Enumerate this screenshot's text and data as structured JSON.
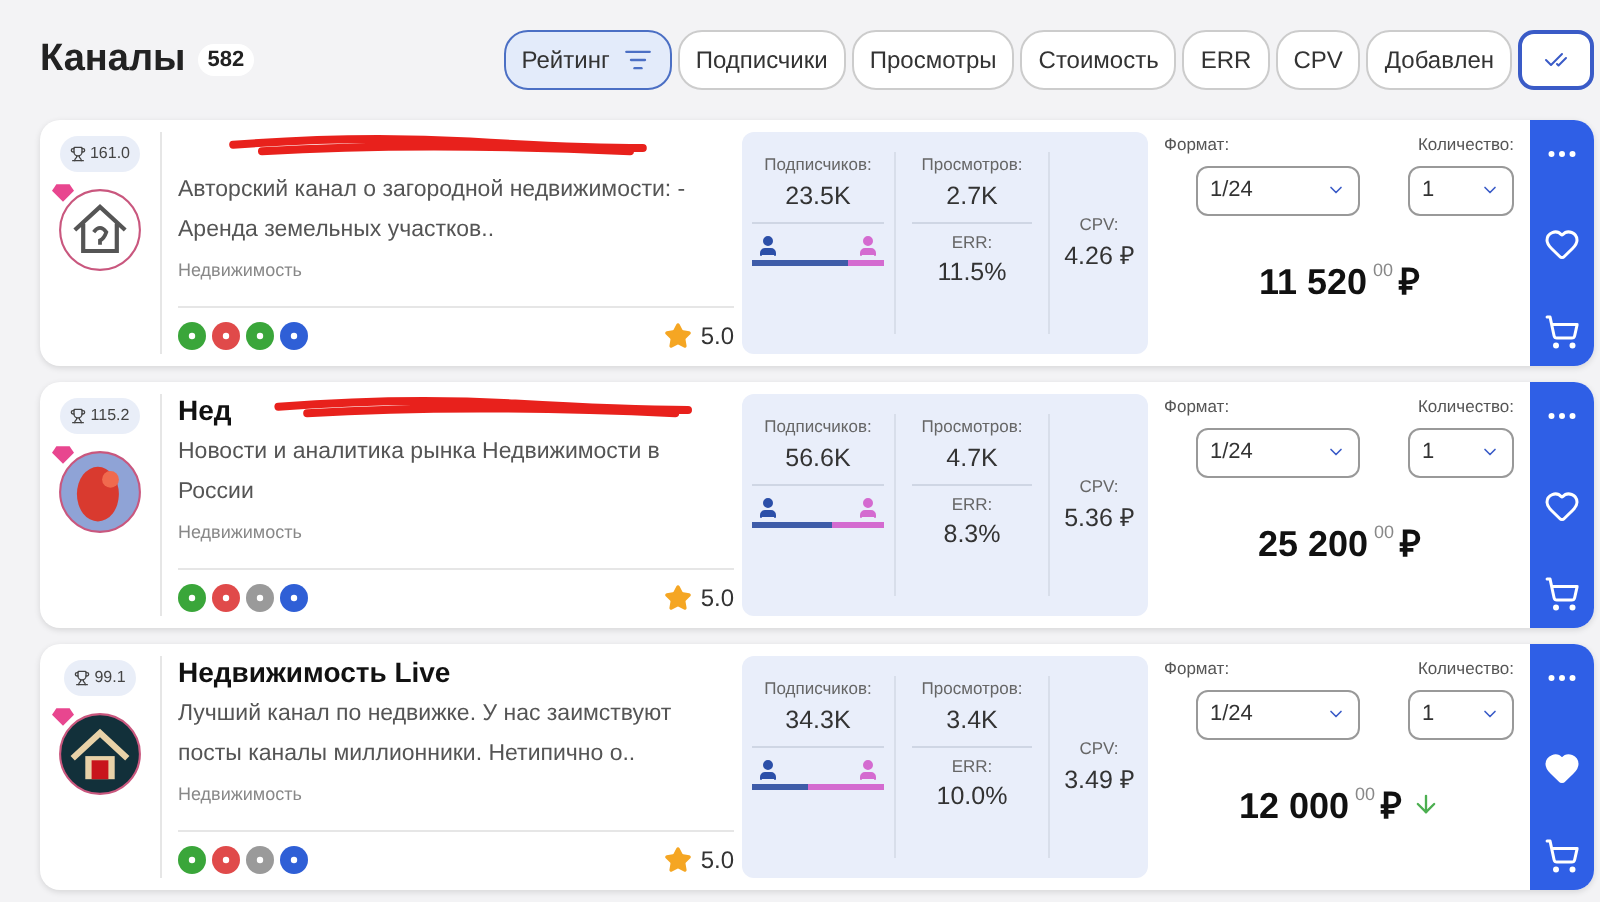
{
  "header": {
    "title": "Каналы",
    "count": "582"
  },
  "sort_tabs": [
    {
      "label": "Рейтинг",
      "selected": true
    },
    {
      "label": "Подписчики",
      "selected": false
    },
    {
      "label": "Просмотры",
      "selected": false
    },
    {
      "label": "Стоимость",
      "selected": false
    },
    {
      "label": "ERR",
      "selected": false
    },
    {
      "label": "CPV",
      "selected": false
    },
    {
      "label": "Добавлен",
      "selected": false
    }
  ],
  "channels": [
    {
      "rating": "161.0",
      "redacted": true,
      "description": "Авторский канал о загородной недвижимости: - Аренда земельных участков..",
      "category": "Недвижимость",
      "badges": [
        {
          "color": "#3aa63a"
        },
        {
          "color": "#e04a4a"
        },
        {
          "color": "#3aa63a"
        },
        {
          "color": "#2f5fd6"
        }
      ],
      "score": "5.0",
      "subscribers_label": "Подписчиков:",
      "subscribers": "23.5K",
      "views_label": "Просмотров:",
      "views": "2.7K",
      "err_label": "ERR:",
      "err": "11.5%",
      "cpv_label": "CPV:",
      "cpv": "4.26 ₽",
      "male": {
        "level": 0.72
      },
      "format_label": "Формат:",
      "format": "1/24",
      "qty_label": "Количество:",
      "qty": "1",
      "price": "11 520",
      "price_cents": "00",
      "currency": "₽",
      "price_down": false,
      "favorite": false
    },
    {
      "rating": "115.2",
      "title": "Нед",
      "redacted": true,
      "description": "Новости и аналитика рынка Недвижимости в России",
      "category": "Недвижимость",
      "badges": [
        {
          "color": "#3aa63a"
        },
        {
          "color": "#e04a4a"
        },
        {
          "color": "#9a9a9a"
        },
        {
          "color": "#2f5fd6"
        }
      ],
      "score": "5.0",
      "subscribers_label": "Подписчиков:",
      "subscribers": "56.6K",
      "views_label": "Просмотров:",
      "views": "4.7K",
      "err_label": "ERR:",
      "err": "8.3%",
      "cpv_label": "CPV:",
      "cpv": "5.36 ₽",
      "male": {
        "level": 0.6
      },
      "format_label": "Формат:",
      "format": "1/24",
      "qty_label": "Количество:",
      "qty": "1",
      "price": "25 200",
      "price_cents": "00",
      "currency": "₽",
      "price_down": false,
      "favorite": false
    },
    {
      "rating": "99.1",
      "title": "Недвижимость Live",
      "redacted": false,
      "description": "Лучший канал по недвижке. У нас заимствуют посты каналы миллионники. Нетипично о..",
      "category": "Недвижимость",
      "badges": [
        {
          "color": "#3aa63a"
        },
        {
          "color": "#e04a4a"
        },
        {
          "color": "#9a9a9a"
        },
        {
          "color": "#2f5fd6"
        }
      ],
      "score": "5.0",
      "subscribers_label": "Подписчиков:",
      "subscribers": "34.3K",
      "views_label": "Просмотров:",
      "views": "3.4K",
      "err_label": "ERR:",
      "err": "10.0%",
      "cpv_label": "CPV:",
      "cpv": "3.49 ₽",
      "male": {
        "level": 0.42
      },
      "format_label": "Формат:",
      "format": "1/24",
      "qty_label": "Количество:",
      "qty": "1",
      "price": "12 000",
      "price_cents": "00",
      "currency": "₽",
      "price_down": true,
      "favorite": true
    }
  ]
}
